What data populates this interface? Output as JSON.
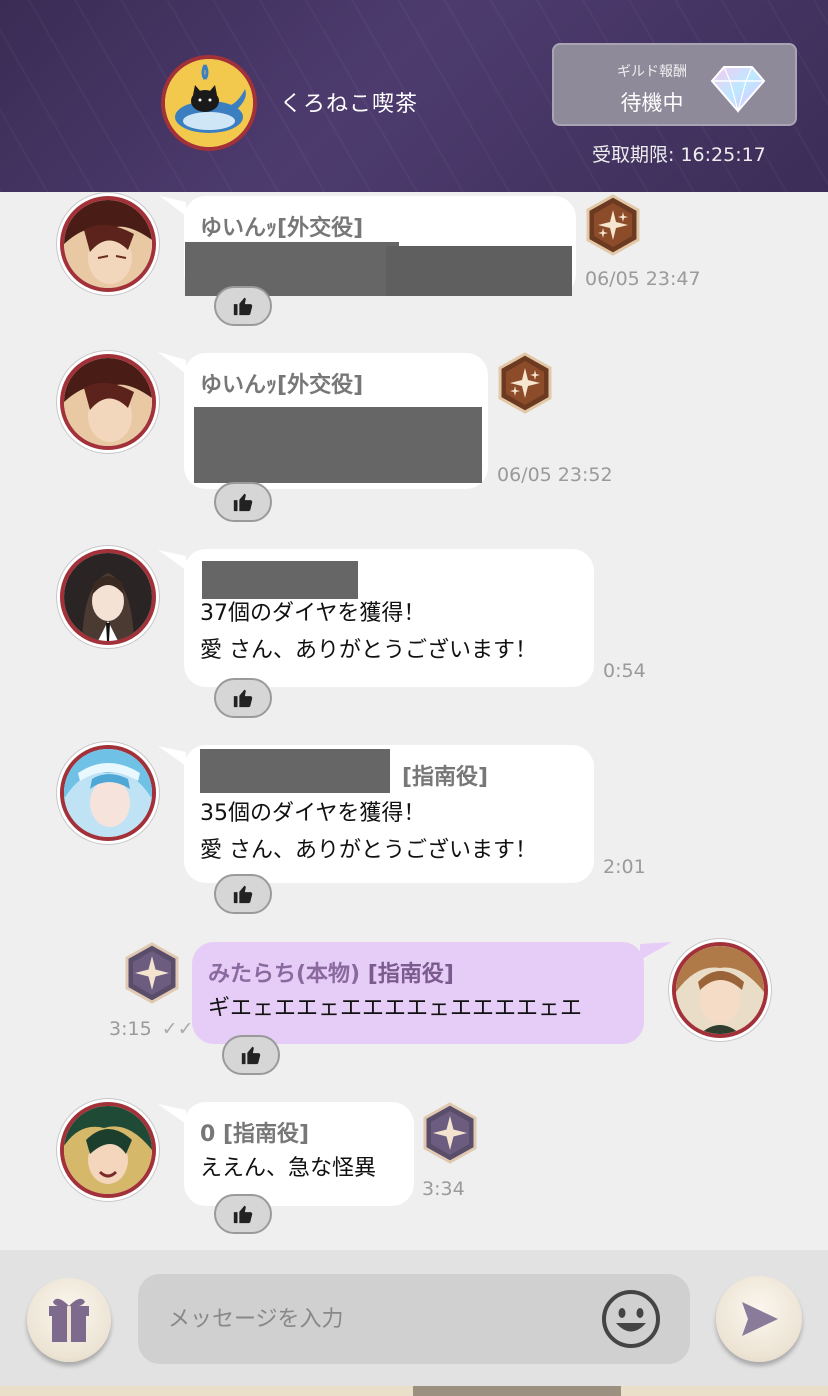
{
  "header": {
    "guild_name": "くろねこ喫茶",
    "guild_logo": "black-cat-on-whale-logo",
    "reward": {
      "label": "ギルド報酬",
      "status": "待機中",
      "icon": "diamond-gem-icon"
    },
    "deadline": "受取期限: 16:25:17"
  },
  "messages": [
    {
      "name": "ゆいんｯ",
      "role": "[外交役]",
      "lines": [],
      "redacted": true,
      "time": "06/05 23:47",
      "badge": "rank-medal-bronze",
      "side": "left"
    },
    {
      "name": "ゆいんｯ",
      "role": "[外交役]",
      "lines": [],
      "redacted": true,
      "time": "06/05 23:52",
      "badge": "rank-medal-bronze",
      "side": "left"
    },
    {
      "name": "",
      "role": "",
      "lines": [
        "37個のダイヤを獲得！",
        "愛 さん、ありがとうございます！"
      ],
      "redacted": true,
      "time": "0:54",
      "side": "left"
    },
    {
      "name": "",
      "role": "[指南役]",
      "lines": [
        "35個のダイヤを獲得！",
        "愛 さん、ありがとうございます！"
      ],
      "redacted": true,
      "time": "2:01",
      "side": "left"
    },
    {
      "name": "みたらち(本物)",
      "role": "[指南役]",
      "lines": [
        "ギエェエエェエエエエェエエエエェエ"
      ],
      "time": "3:15",
      "read": "✓✓",
      "badge": "rank-medal-silver",
      "side": "right"
    },
    {
      "name": "0",
      "role": "[指南役]",
      "lines": [
        "ええん、急な怪異"
      ],
      "time": "3:34",
      "badge": "rank-medal-silver",
      "side": "left"
    }
  ],
  "composer": {
    "placeholder": "メッセージを入力",
    "gift_icon": "gift-icon",
    "emoji_icon": "smiley-icon",
    "send_icon": "send-arrow-icon"
  }
}
